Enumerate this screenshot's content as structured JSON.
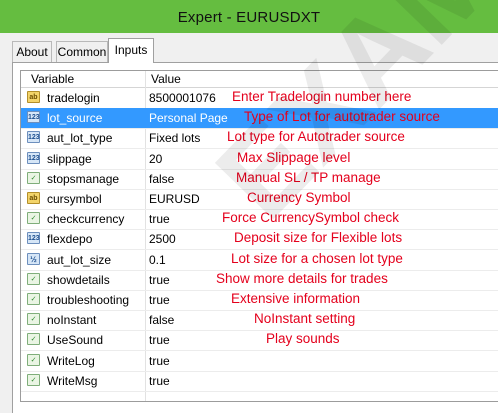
{
  "window": {
    "title": "Expert - EURUSDXT"
  },
  "tabs": [
    {
      "label": "About"
    },
    {
      "label": "Common"
    },
    {
      "label": "Inputs"
    }
  ],
  "grid": {
    "headers": {
      "variable": "Variable",
      "value": "Value"
    },
    "rows": [
      {
        "icon": "string-icon",
        "name": "tradelogin",
        "value": "8500001076",
        "note": "Enter Tradelogin number here",
        "selected": false
      },
      {
        "icon": "integer-icon",
        "name": "lot_source",
        "value": "Personal Page",
        "note": "Type of Lot for  autotrader source",
        "selected": true
      },
      {
        "icon": "integer-icon",
        "name": "aut_lot_type",
        "value": "Fixed lots",
        "note": "Lot type for Autotrader source",
        "selected": false
      },
      {
        "icon": "integer-icon",
        "name": "slippage",
        "value": "20",
        "note": "Max Slippage level",
        "selected": false
      },
      {
        "icon": "boolean-icon",
        "name": "stopsmanage",
        "value": "false",
        "note": "Manual SL / TP manage",
        "selected": false
      },
      {
        "icon": "string-icon",
        "name": "cursymbol",
        "value": "EURUSD",
        "note": "Currency Symbol",
        "selected": false
      },
      {
        "icon": "boolean-icon",
        "name": "checkcurrency",
        "value": "true",
        "note": "Force CurrencySymbol check",
        "selected": false
      },
      {
        "icon": "integer-icon",
        "name": "flexdepo",
        "value": "2500",
        "note": "Deposit size for Flexible lots",
        "selected": false
      },
      {
        "icon": "double-icon",
        "name": "aut_lot_size",
        "value": "0.1",
        "note": "Lot size for a chosen lot type",
        "selected": false
      },
      {
        "icon": "boolean-icon",
        "name": "showdetails",
        "value": "true",
        "note": "Show more details for trades",
        "selected": false
      },
      {
        "icon": "boolean-icon",
        "name": "troubleshooting",
        "value": "true",
        "note": "Extensive information",
        "selected": false
      },
      {
        "icon": "boolean-icon",
        "name": "noInstant",
        "value": "false",
        "note": "NoInstant setting",
        "selected": false
      },
      {
        "icon": "boolean-icon",
        "name": "UseSound",
        "value": "true",
        "note": "Play sounds",
        "selected": false
      },
      {
        "icon": "boolean-icon",
        "name": "WriteLog",
        "value": "true",
        "note": "",
        "selected": false
      },
      {
        "icon": "boolean-icon",
        "name": "WriteMsg",
        "value": "true",
        "note": "",
        "selected": false
      }
    ]
  },
  "icon_glyphs": {
    "string-icon": "ab",
    "integer-icon": "123",
    "boolean-icon": "✓",
    "double-icon": "½"
  },
  "watermark": "EXAMPLE",
  "colors": {
    "titlebar": "#65bd40",
    "selection": "#3399ff",
    "note_text": "#e4001c"
  }
}
